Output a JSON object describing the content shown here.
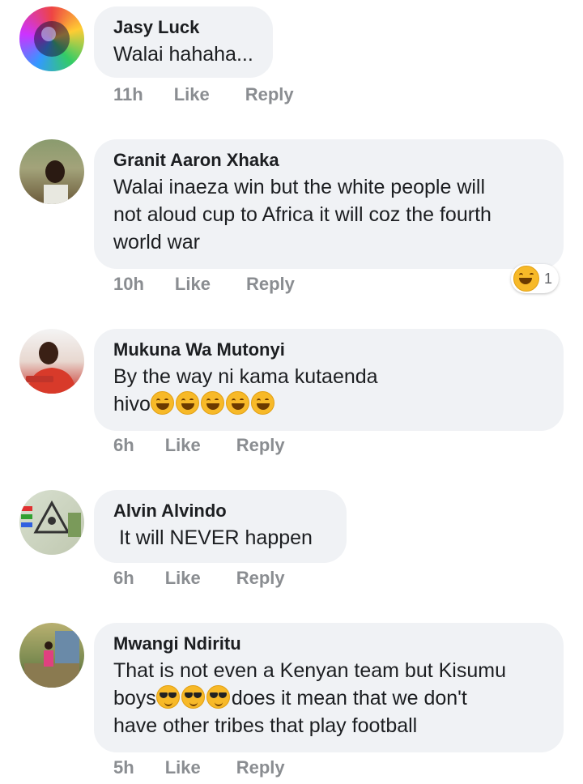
{
  "comments": [
    {
      "name": "Jasy Luck",
      "text": "Walai hahaha...",
      "time": "11h",
      "like": "Like",
      "reply": "Reply"
    },
    {
      "name": "Granit Aaron Xhaka",
      "text_lines": [
        "Walai inaeza win but the white people will",
        "not aloud cup to Africa it will coz the fourth",
        "world war"
      ],
      "time": "10h",
      "like": "Like",
      "reply": "Reply",
      "reaction": {
        "icon": "laughing-emoji-icon",
        "count": "1"
      }
    },
    {
      "name": "Mukuna Wa Mutonyi",
      "text_lines": [
        "By the way ni kama kutaenda",
        "hivo"
      ],
      "emojis": [
        "laughing-crying-emoji-icon",
        "laughing-crying-emoji-icon",
        "laughing-crying-emoji-icon",
        "laughing-crying-emoji-icon",
        "laughing-crying-emoji-icon"
      ],
      "time": "6h",
      "like": "Like",
      "reply": "Reply"
    },
    {
      "name": "Alvin Alvindo",
      "text": " It will NEVER happen",
      "time": "6h",
      "like": "Like",
      "reply": "Reply"
    },
    {
      "name": "Mwangi Ndiritu",
      "text_lines": [
        "That is not even a Kenyan team but Kisumu",
        "boys",
        "does it mean that we don't",
        "have other tribes that play football"
      ],
      "emojis": [
        "sunglasses-emoji-icon",
        "sunglasses-emoji-icon",
        "sunglasses-emoji-icon"
      ],
      "time": "5h",
      "like": "Like",
      "reply": "Reply"
    }
  ],
  "colors": {
    "bubble": "#f0f2f5",
    "meta": "#8a8d91",
    "text": "#1c1e21",
    "emoji": "#f7b928"
  }
}
